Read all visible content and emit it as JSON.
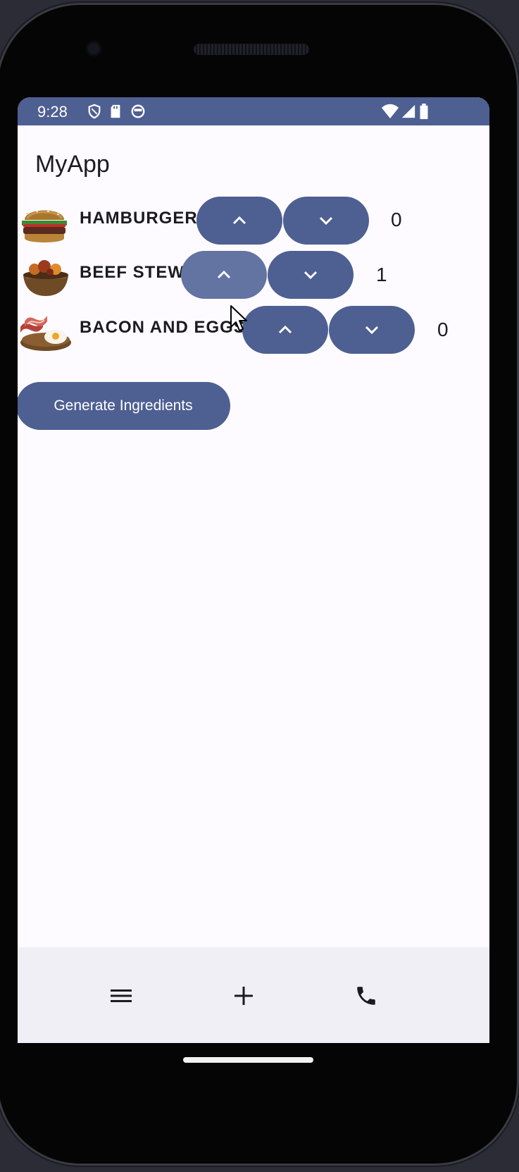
{
  "status_bar": {
    "time": "9:28",
    "icons": [
      "shield-icon",
      "sd-card-icon",
      "sync-icon",
      "wifi-icon",
      "signal-icon",
      "battery-icon"
    ]
  },
  "app": {
    "title": "MyApp"
  },
  "foods": [
    {
      "name": "HAMBURGER",
      "count": "0",
      "image_icon": "hamburger-image"
    },
    {
      "name": "BEEF STEW",
      "count": "1",
      "image_icon": "beef-stew-image"
    },
    {
      "name": "BACON AND EGGS",
      "count": "0",
      "image_icon": "bacon-and-eggs-image"
    }
  ],
  "buttons": {
    "increment_icon": "chevron-up-icon",
    "decrement_icon": "chevron-down-icon",
    "generate_label": "Generate Ingredients"
  },
  "bottom_nav": {
    "icons": [
      "menu-icon",
      "add-icon",
      "phone-icon"
    ]
  },
  "colors": {
    "primary": "#4e5f92",
    "primary_pressed": "#6373a2",
    "background": "#fdfbff",
    "bottom_bar": "#efeff5"
  }
}
